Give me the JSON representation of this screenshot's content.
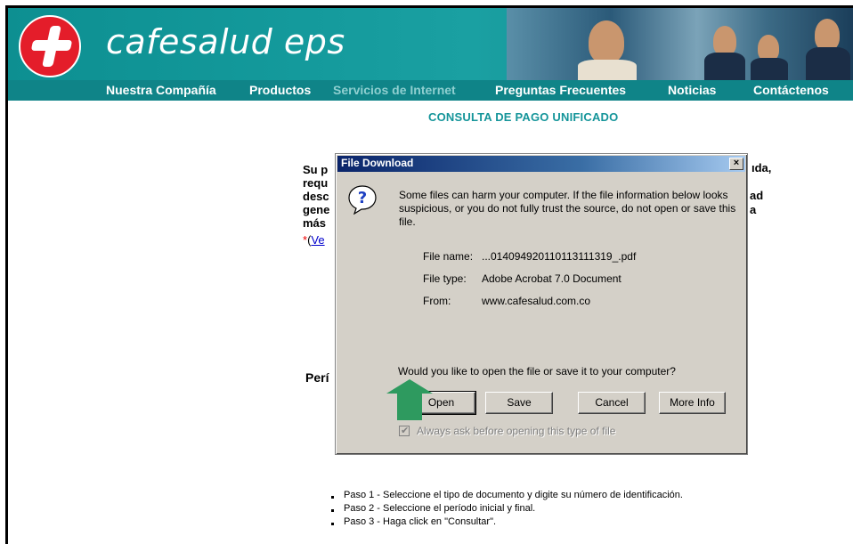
{
  "brand": "cafesalud eps",
  "nav": [
    {
      "label": "Nuestra Compañía",
      "active": true
    },
    {
      "label": "Productos",
      "active": true
    },
    {
      "label": "Servicios de Internet",
      "active": false
    },
    {
      "label": "Preguntas Frecuentes",
      "active": true
    },
    {
      "label": "Noticias",
      "active": true
    },
    {
      "label": "Contáctenos",
      "active": true
    }
  ],
  "page_title": "CONSULTA DE PAGO UNIFICADO",
  "background_text": {
    "lines": [
      "Su p",
      "requ",
      "desc",
      "gene",
      "más"
    ],
    "right_fragments": [
      "ıda,",
      "ad",
      "a"
    ],
    "link_star": "*",
    "link_paren": "(",
    "link_text": "Ve",
    "periodo": "Perí"
  },
  "steps": [
    "Paso 1 - Seleccione el tipo de documento y digite su número de identificación.",
    "Paso 2 - Seleccione el período inicial y final.",
    "Paso 3 - Haga click en \"Consultar\"."
  ],
  "dialog": {
    "title": "File Download",
    "close_label": "×",
    "warning": "Some files can harm your computer. If the file information below looks suspicious, or you do not fully trust the source, do not open or save this file.",
    "file_name_label": "File name:",
    "file_name_value": "...0140949201101131113​19_.pdf",
    "file_type_label": "File type:",
    "file_type_value": "Adobe Acrobat 7.0 Document",
    "from_label": "From:",
    "from_value": "www.cafesalud.com.co",
    "question": "Would you like to open the file or save it to your computer?",
    "buttons": {
      "open": "Open",
      "save": "Save",
      "cancel": "Cancel",
      "more_info": "More Info"
    },
    "checkbox_label": "Always ask before opening this type of file",
    "checkbox_checked": true
  },
  "colors": {
    "teal": "#0f8488",
    "title_teal": "#15959a",
    "dialog_title": "#0a246a",
    "arrow": "#2e9a5f"
  }
}
